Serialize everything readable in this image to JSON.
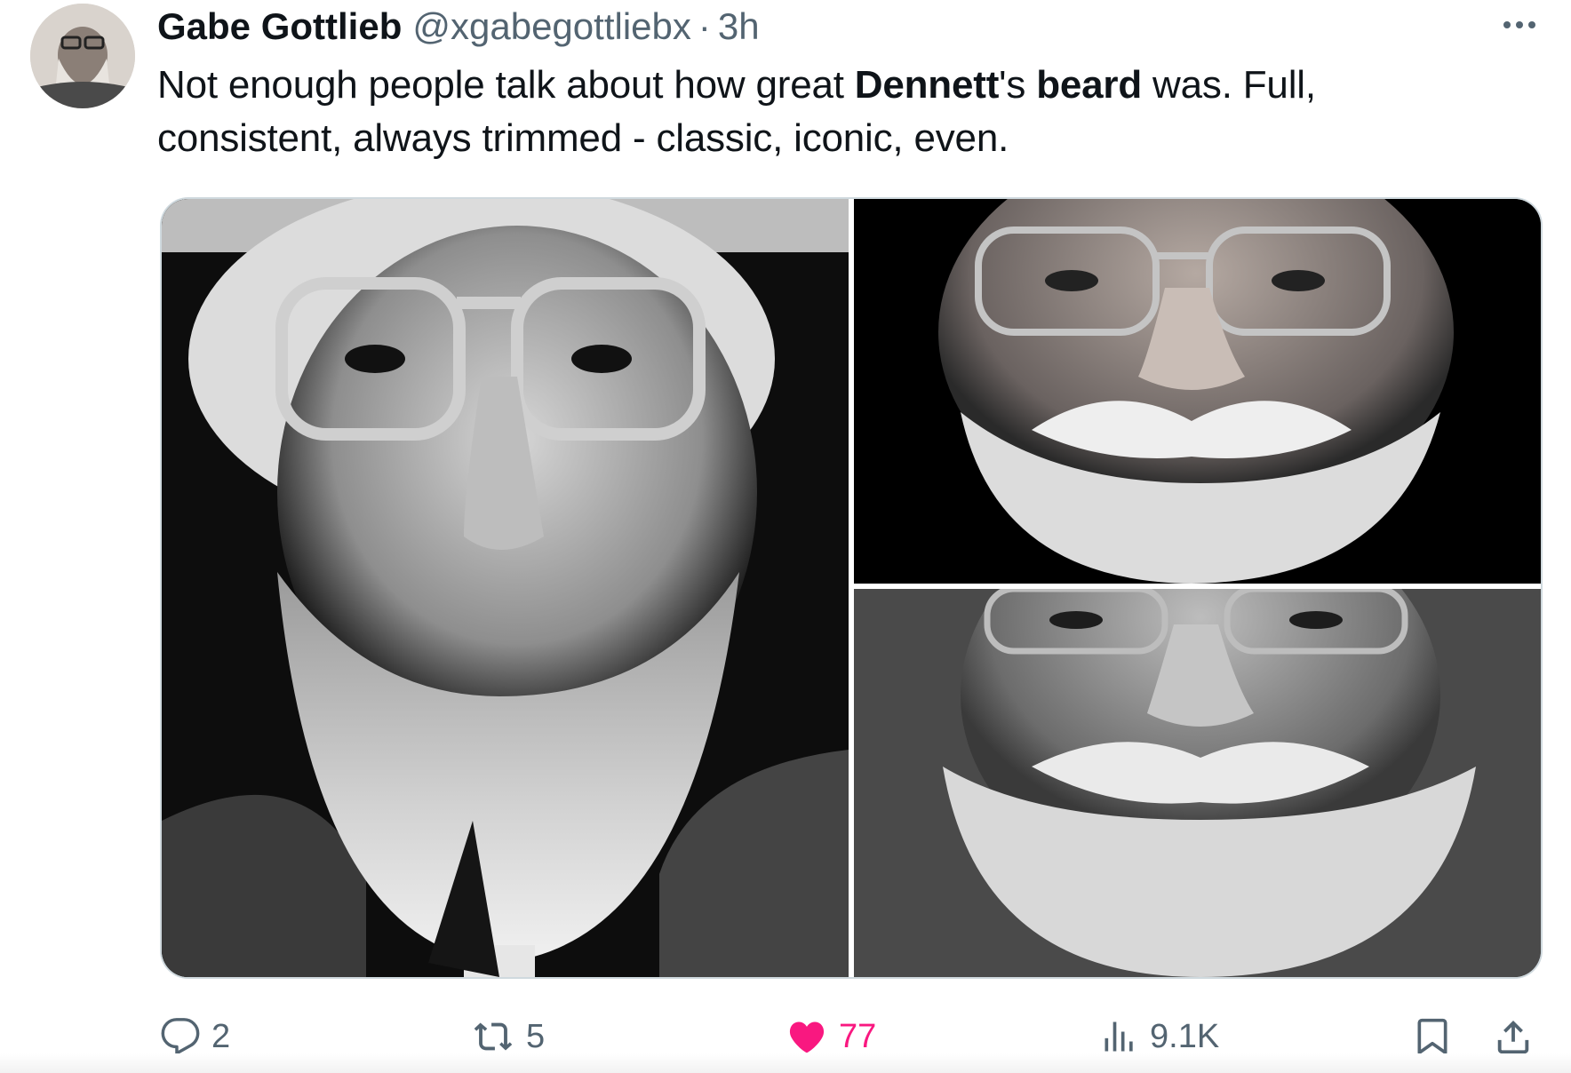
{
  "tweet": {
    "display_name": "Gabe Gottlieb",
    "handle": "@xgabegottliebx",
    "separator": "·",
    "timestamp": "3h",
    "text_parts": {
      "p1": "Not enough people talk about how great ",
      "b1": "Dennett",
      "p2": "'s ",
      "b2": "beard",
      "p3": " was. Full, consistent, always trimmed - classic, iconic, even."
    }
  },
  "media": {
    "photos": [
      "photo-left",
      "photo-top-right",
      "photo-bottom-right"
    ]
  },
  "actions": {
    "replies": "2",
    "reposts": "5",
    "likes": "77",
    "views": "9.1K"
  },
  "icons": {
    "more": "more-horizontal-icon",
    "reply": "reply-bubble-icon",
    "repost": "repost-icon",
    "like": "heart-icon",
    "views": "views-bar-chart-icon",
    "bookmark": "bookmark-icon",
    "share": "share-icon"
  },
  "colors": {
    "like_active": "#f91880",
    "secondary_text": "#536471",
    "primary_text": "#0f1419",
    "border": "#cfd9de"
  }
}
